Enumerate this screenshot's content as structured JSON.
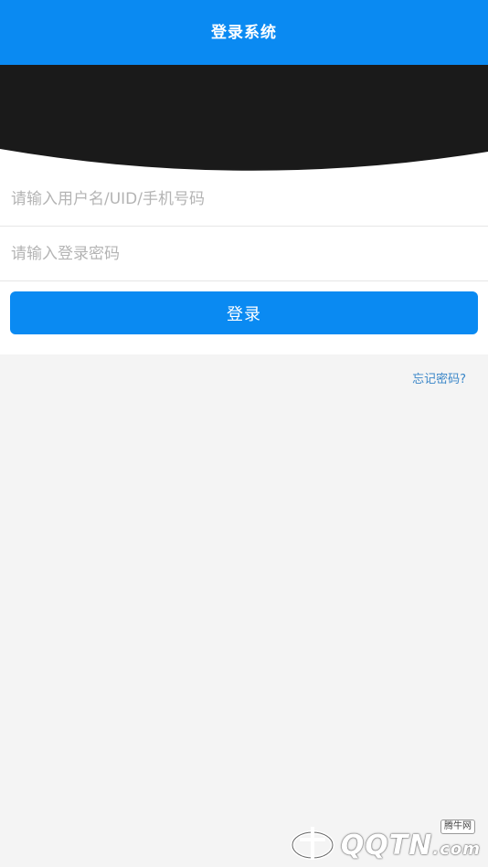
{
  "header": {
    "title": "登录系统"
  },
  "form": {
    "username_placeholder": "请输入用户名/UID/手机号码",
    "username_value": "",
    "password_placeholder": "请输入登录密码",
    "password_value": "",
    "login_label": "登录"
  },
  "links": {
    "forgot_password": "忘记密码?"
  },
  "watermark": {
    "badge": "腾牛网",
    "text_main": "QQTN",
    "text_suffix": ".com"
  },
  "colors": {
    "primary": "#0a8af2",
    "banner": "#1a1a1a",
    "background": "#f4f4f4",
    "link": "#3a86c8"
  }
}
